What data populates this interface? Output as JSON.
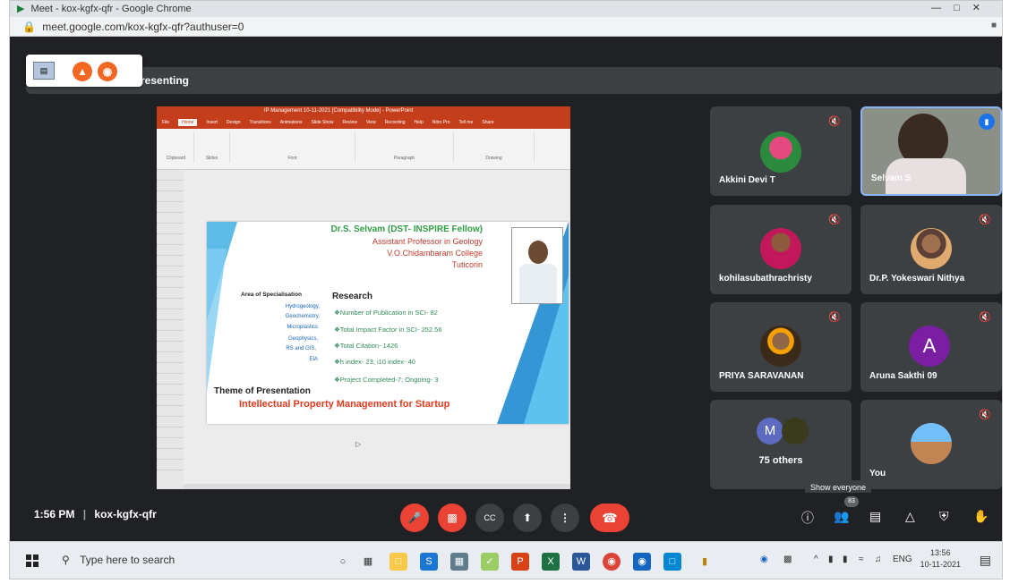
{
  "browser": {
    "title": "Meet - kox-kgfx-qfr - Google Chrome",
    "url": "meet.google.com/kox-kgfx-qfr?authuser=0"
  },
  "presenting_label": "resenting",
  "ppt": {
    "window_title": "IP Management 10-11-2021 [Compatibility Mode] - PowerPoint",
    "tabs": [
      "File",
      "Home",
      "Insert",
      "Design",
      "Transitions",
      "Animations",
      "Slide Show",
      "Review",
      "View",
      "Recording",
      "Help",
      "Nitro Pro",
      "Tell me",
      "Share"
    ],
    "active_tab": "Home",
    "groups": [
      "Clipboard",
      "Slides",
      "Font",
      "Paragraph",
      "Drawing"
    ],
    "slide": {
      "name": "Dr.S. Selvam (DST- INSPIRE Fellow)",
      "lines": [
        "Assistant Professor in Geology",
        "V.O.Chidambaram College",
        "Tuticorin"
      ],
      "aos_title": "Area of Specialisation",
      "specialisations": [
        "Hydrogeology,",
        "Geochemistry,",
        "Microplastics",
        "Geophysics,",
        "RS and GIS,",
        "EIA"
      ],
      "research_title": "Research",
      "research": [
        "❖Number of Publication in SCI- 82",
        "❖Total Impact Factor in SCI- 252.56",
        "❖Total Citation- 1426",
        "❖h index- 23; i10 index- 40",
        "❖Project Completed-7; Ongoing- 3"
      ],
      "theme_label": "Theme of Presentation",
      "theme_title": "Intellectual Property Management for Startup"
    }
  },
  "participants": [
    {
      "name": "Akkini Devi T",
      "muted": true
    },
    {
      "name": "Selvam S",
      "speaking": true
    },
    {
      "name": "kohilasubathrachristy",
      "muted": true
    },
    {
      "name": "Dr.P. Yokeswari Nithya",
      "muted": true
    },
    {
      "name": "PRIYA SARAVANAN",
      "muted": true
    },
    {
      "name": "Aruna Sakthi 09",
      "muted": true,
      "initial": "A"
    },
    {
      "others_initial": "M",
      "label": "75 others"
    },
    {
      "name": "You",
      "muted": true
    }
  ],
  "meeting": {
    "time": "1:56 PM",
    "code": "kox-kgfx-qfr",
    "participant_count": "83",
    "tooltip": "Show everyone"
  },
  "taskbar": {
    "search_placeholder": "Type here to search",
    "lang": "ENG",
    "clock_time": "13:56",
    "clock_date": "10-11-2021"
  }
}
